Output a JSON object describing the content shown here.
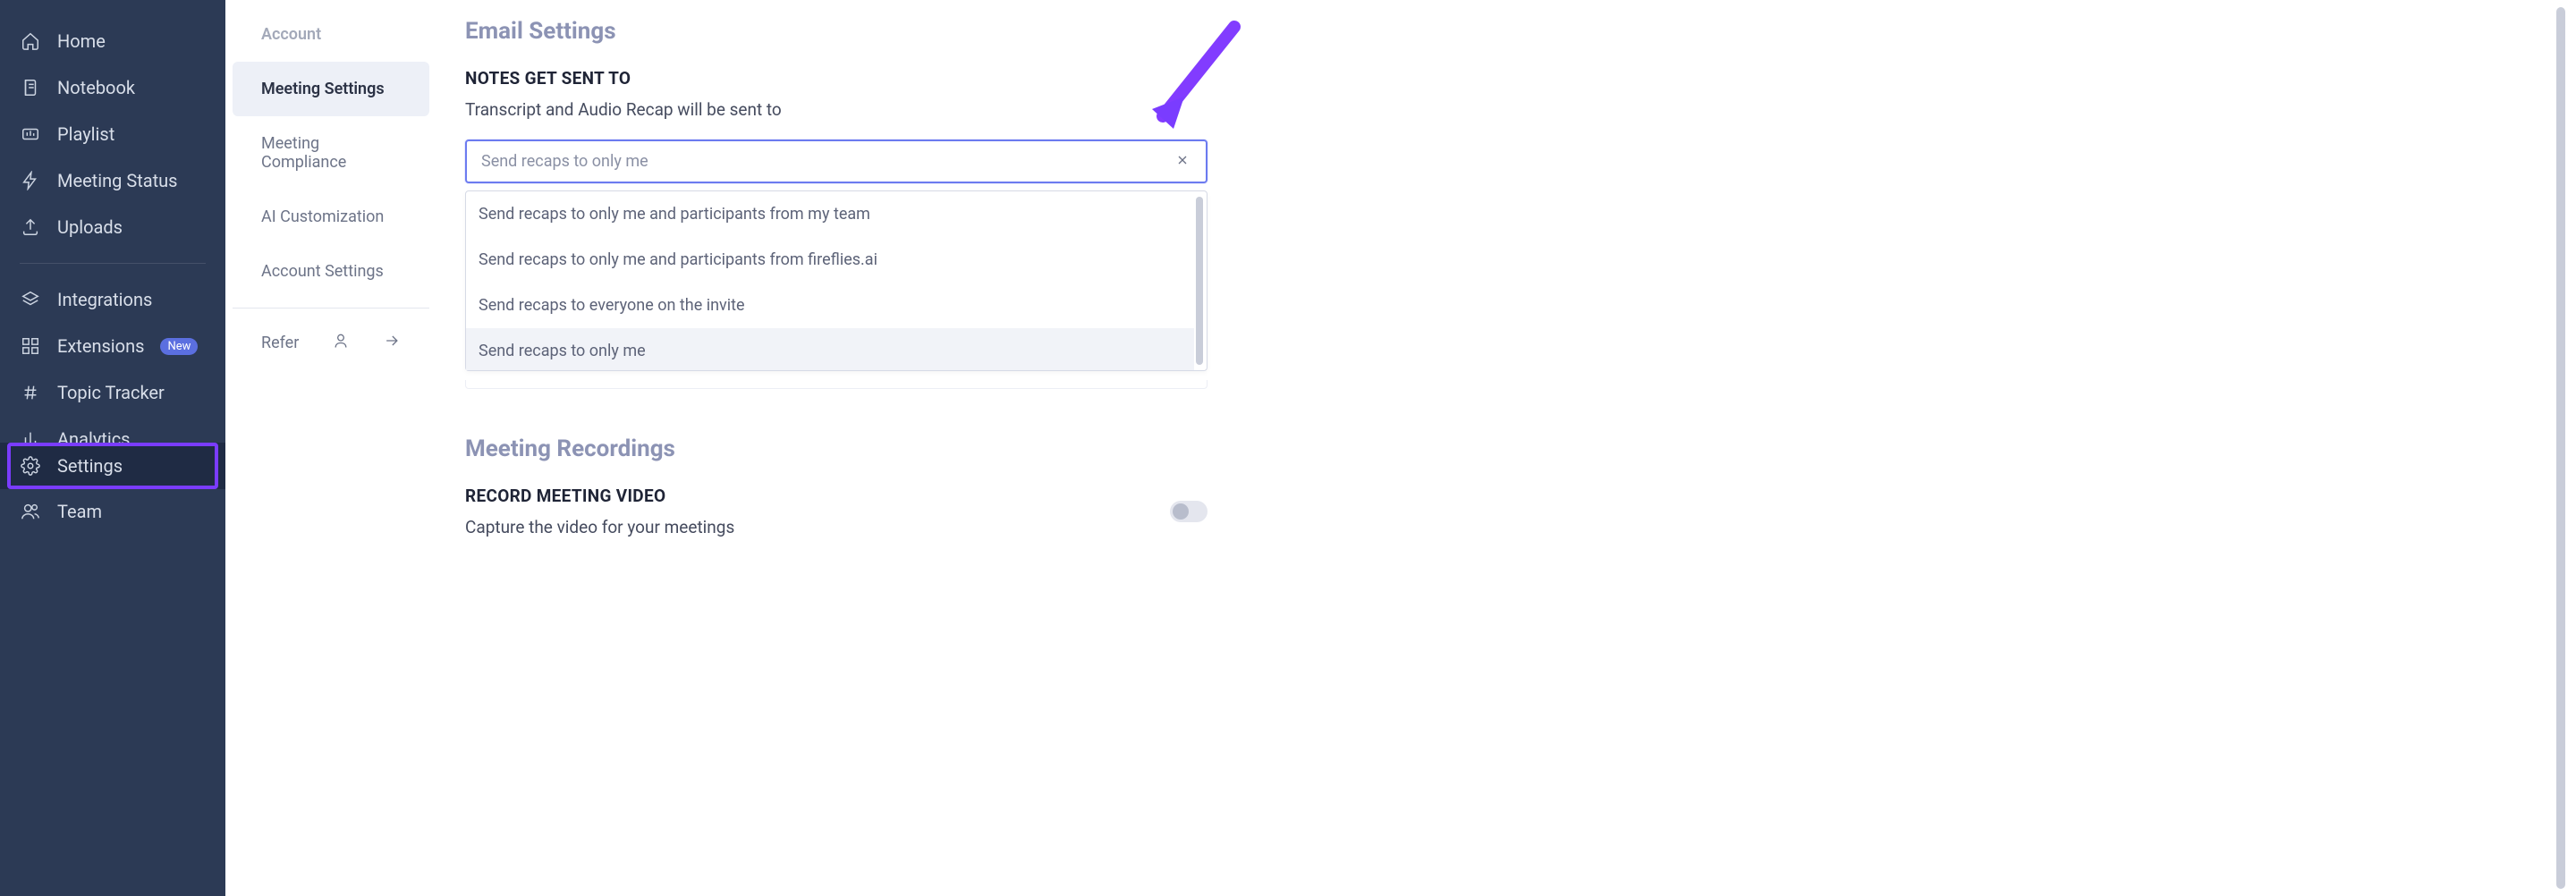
{
  "sidebar": {
    "items": [
      {
        "id": "home",
        "label": "Home"
      },
      {
        "id": "notebook",
        "label": "Notebook"
      },
      {
        "id": "playlist",
        "label": "Playlist"
      },
      {
        "id": "meeting-status",
        "label": "Meeting Status"
      },
      {
        "id": "uploads",
        "label": "Uploads"
      },
      {
        "id": "integrations",
        "label": "Integrations"
      },
      {
        "id": "extensions",
        "label": "Extensions",
        "badge": "New"
      },
      {
        "id": "topic-tracker",
        "label": "Topic Tracker"
      },
      {
        "id": "analytics",
        "label": "Analytics"
      },
      {
        "id": "team",
        "label": "Team"
      },
      {
        "id": "settings",
        "label": "Settings"
      }
    ]
  },
  "subnav": {
    "heading": "Account",
    "items": [
      {
        "id": "meeting-settings",
        "label": "Meeting Settings",
        "active": true
      },
      {
        "id": "meeting-compliance",
        "label": "Meeting Compliance"
      },
      {
        "id": "ai-customization",
        "label": "AI Customization"
      },
      {
        "id": "account-settings",
        "label": "Account Settings"
      }
    ],
    "refer_label": "Refer"
  },
  "email_settings": {
    "title": "Email Settings",
    "heading": "NOTES GET SENT TO",
    "subtext": "Transcript and Audio Recap will be sent to",
    "selected_placeholder": "Send recaps to only me",
    "options": [
      "Send recaps to only me and participants from my team",
      "Send recaps to only me and participants from fireflies.ai",
      "Send recaps to everyone on the invite",
      "Send recaps to only me"
    ],
    "hovered_index": 3
  },
  "meeting_recordings": {
    "title": "Meeting Recordings",
    "heading": "RECORD MEETING VIDEO",
    "subtext": "Capture the video for your meetings",
    "toggle_on": false
  },
  "colors": {
    "accent": "#6c7bf0",
    "annotation": "#7a3cff"
  }
}
